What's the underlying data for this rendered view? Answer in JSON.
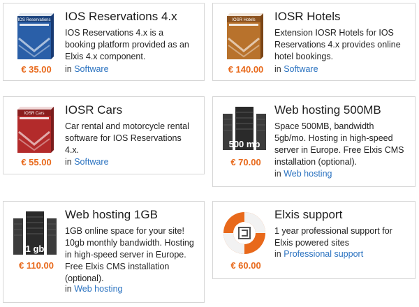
{
  "products": [
    {
      "title": "IOS Reservations 4.x",
      "description": "IOS Reservations 4.x is a booking platform provided as an Elxis 4.x component.",
      "price": "€ 35.00",
      "category_prefix": "in",
      "category": "Software",
      "image_label": "IOS Reservations",
      "image_icon": "ios-reservations-box-icon",
      "box_color": "#2a5fa8"
    },
    {
      "title": "IOSR Hotels",
      "description": "Extension IOSR Hotels for IOS Reservations 4.x provides online hotel bookings.",
      "price": "€ 140.00",
      "category_prefix": "in",
      "category": "Software",
      "image_label": "IOSR Hotels",
      "image_icon": "iosr-hotels-box-icon",
      "box_color": "#b8722c"
    },
    {
      "title": "IOSR Cars",
      "description": "Car rental and motorcycle rental software for IOS Reservations 4.x.",
      "price": "€ 55.00",
      "category_prefix": "in",
      "category": "Software",
      "image_label": "IOSR Cars",
      "image_icon": "iosr-cars-box-icon",
      "box_color": "#b32b2b"
    },
    {
      "title": "Web hosting 500MB",
      "description": "Space 500MB, bandwidth 5gb/mo. Hosting in high-speed server in Europe. Free Elxis CMS installation (optional).",
      "price": "€ 70.00",
      "category_prefix": "in",
      "category": "Web hosting",
      "image_label": "500 mb",
      "image_icon": "server-rack-icon"
    },
    {
      "title": "Web hosting 1GB",
      "description": "1GB online space for your site! 10gb monthly bandwidth. Hosting in high-speed server in Europe. Free Elxis CMS installation (optional).",
      "price": "€ 110.00",
      "category_prefix": "in",
      "category": "Web hosting",
      "image_label": "1 gb",
      "image_icon": "server-rack-icon"
    },
    {
      "title": "Elxis support",
      "description": "1 year professional support for Elxis powered sites",
      "price": "€ 60.00",
      "category_prefix": "in",
      "category": "Professional support",
      "image_icon": "lifebuoy-icon"
    }
  ]
}
